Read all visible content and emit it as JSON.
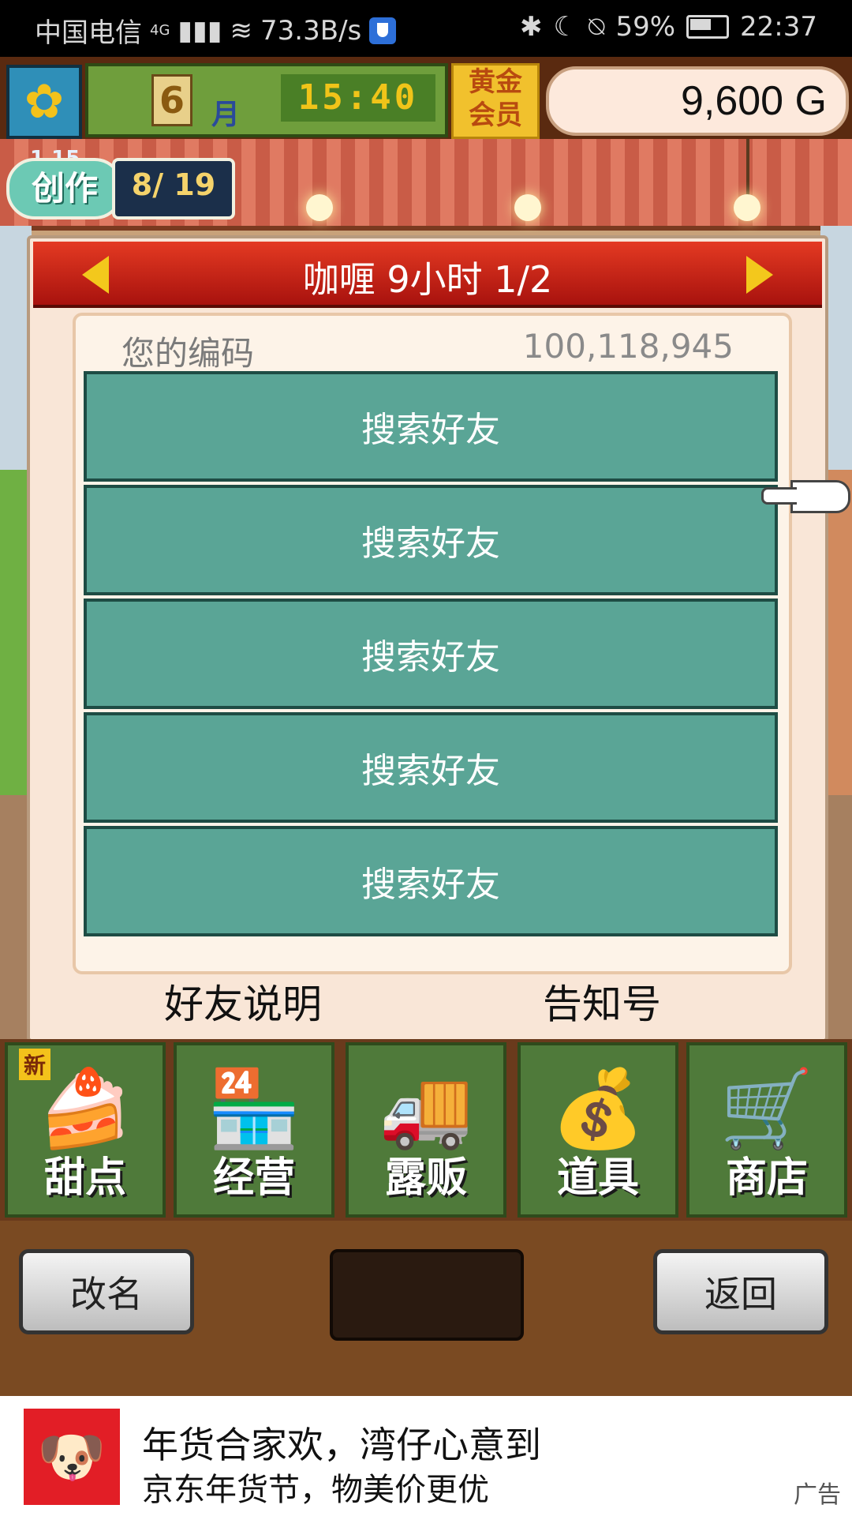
{
  "status_bar": {
    "carrier": "中国电信",
    "network": "4G",
    "speed": "73.3B/s",
    "battery": "59%",
    "time": "22:37"
  },
  "top_bar": {
    "month_num": "6",
    "month_label": "月",
    "clock": "15:40",
    "gold_member_line1": "黄金",
    "gold_member_line2": "会员",
    "money": "9,600 G"
  },
  "create_badge": {
    "level": "1 15",
    "label": "创作",
    "count": "8/ 19"
  },
  "dialog": {
    "title": "咖喱  9小时 1/2",
    "code_label": "您的编码",
    "code_value": "100,118,945",
    "friend_buttons": [
      "搜索好友",
      "搜索好友",
      "搜索好友",
      "搜索好友",
      "搜索好友"
    ],
    "help_link": "好友说明",
    "notice_link": "告知号"
  },
  "nav": {
    "items": [
      {
        "label": "甜点",
        "icon": "cake-icon",
        "badge": "新"
      },
      {
        "label": "经营",
        "icon": "store-icon"
      },
      {
        "label": "露贩",
        "icon": "food-truck-icon"
      },
      {
        "label": "道具",
        "icon": "items-bag-icon"
      },
      {
        "label": "商店",
        "icon": "shopping-cart-icon"
      }
    ]
  },
  "bottom": {
    "rename": "改名",
    "back": "返回"
  },
  "ad": {
    "line1": "年货合家欢，湾仔心意到",
    "line2": "京东年货节，物美价更优",
    "tag": "广告"
  }
}
